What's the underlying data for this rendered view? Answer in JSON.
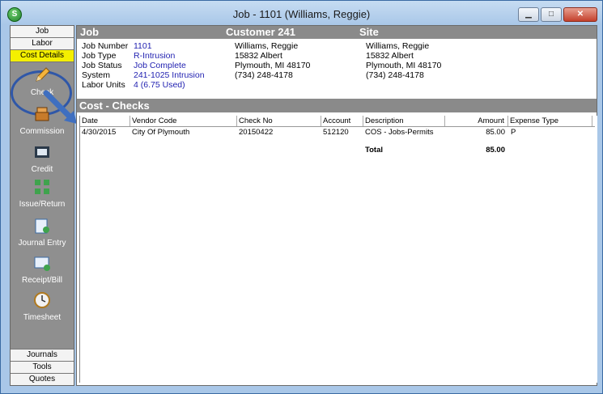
{
  "window": {
    "title": "Job - 1101 (Williams, Reggie)",
    "app_icon": "S"
  },
  "window_buttons": {
    "minimize": "▁",
    "maximize": "□",
    "close": "✕"
  },
  "sidebar": {
    "tabs": [
      "Job",
      "Labor",
      "Cost Details"
    ],
    "items": [
      "Check",
      "Commission",
      "Credit",
      "Issue/Return",
      "Journal Entry",
      "Receipt/Bill",
      "Timesheet"
    ],
    "bottom_tabs": [
      "Journals",
      "Tools",
      "Quotes"
    ]
  },
  "header": {
    "job": "Job",
    "customer": "Customer 241",
    "site": "Site"
  },
  "job_info": {
    "labels": [
      "Job Number",
      "Job Type",
      "Job Status",
      "System",
      "Labor Units"
    ],
    "values": [
      "1101",
      "R-Intrusion",
      "Job Complete",
      "241-1025 Intrusion",
      "4 (6.75 Used)"
    ]
  },
  "customer_info": [
    "Williams, Reggie",
    "15832 Albert",
    "Plymouth, MI  48170",
    "(734) 248-4178"
  ],
  "site_info": [
    "Williams, Reggie",
    "15832 Albert",
    "Plymouth, MI  48170",
    "(734) 248-4178"
  ],
  "section": {
    "title": "Cost - Checks"
  },
  "grid": {
    "columns": [
      "Date",
      "Vendor Code",
      "Check No",
      "Account",
      "Description",
      "Amount",
      "Expense Type"
    ],
    "rows": [
      {
        "date": "4/30/2015",
        "vendor": "City Of Plymouth",
        "check_no": "20150422",
        "account": "512120",
        "description": "COS - Jobs-Permits",
        "amount": "85.00",
        "expense_type": "P"
      }
    ],
    "total_label": "Total",
    "total_amount": "85.00"
  },
  "colors": {
    "accent_active_tab": "#f4ef00",
    "header_bg": "#8a8a8a",
    "link_blue": "#1f1fb0"
  }
}
